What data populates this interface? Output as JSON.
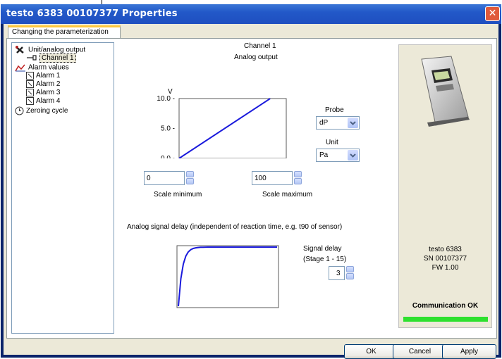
{
  "window": {
    "title": "testo 6383  00107377 Properties"
  },
  "tabs": [
    {
      "label": "Changing the parameterization"
    }
  ],
  "tree": {
    "unit_output": "Unit/analog output",
    "channel1": "Channel 1",
    "alarm_values": "Alarm values",
    "alarms": [
      "Alarm 1",
      "Alarm 2",
      "Alarm 3",
      "Alarm 4"
    ],
    "zeroing": "Zeroing cycle"
  },
  "main": {
    "channel_title": "Channel 1",
    "channel_subtitle": "Analog output",
    "probe_label": "Probe",
    "probe_value": "dP",
    "unit_label": "Unit",
    "unit_value": "Pa",
    "scale_min_value": "0",
    "scale_max_value": "100",
    "scale_min_label": "Scale minimum",
    "scale_max_label": "Scale maximum",
    "delay_heading": "Analog signal delay (independent of reaction time, e.g. t90 of sensor)",
    "signal_delay_label": "Signal delay",
    "signal_delay_range": "(Stage 1 - 15)",
    "signal_delay_value": "3"
  },
  "chart_data": {
    "type": "line",
    "ylabel": "V",
    "yticks": [
      "10.0",
      "5.0",
      "0.0"
    ],
    "xticks": [
      "0",
      "50",
      "100"
    ],
    "xlim": [
      0,
      100
    ],
    "ylim": [
      0,
      10
    ],
    "series": [
      {
        "x": [
          0,
          100
        ],
        "y": [
          0,
          10
        ]
      }
    ]
  },
  "device": {
    "name": "testo 6383",
    "serial": "SN 00107377",
    "firmware": "FW  1.00",
    "status": "Communication OK"
  },
  "buttons": {
    "ok": "OK",
    "cancel": "Cancel",
    "apply": "Apply"
  },
  "colors": {
    "title_bar": "#2258c8",
    "line": "#1a1adc",
    "progress": "#2ee02e"
  }
}
